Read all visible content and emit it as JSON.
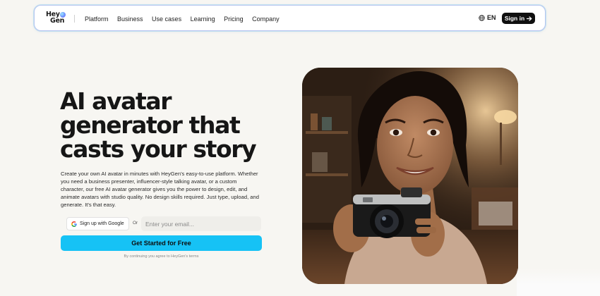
{
  "nav": {
    "logo_line1": "Hey",
    "logo_line2": "Gen",
    "items": [
      "Platform",
      "Business",
      "Use cases",
      "Learning",
      "Pricing",
      "Company"
    ],
    "lang": "EN",
    "signin": "Sign in"
  },
  "hero": {
    "title_line1": "AI avatar",
    "title_line2": "generator that",
    "title_line3": "casts your story",
    "description": "Create your own AI avatar in minutes with HeyGen's easy-to-use platform. Whether you need a business presenter, influencer-style talking avatar, or a custom character, our free AI avatar generator gives you the power to design, edit, and animate avatars with studio quality. No design skills required. Just type, upload, and generate. It's that easy.",
    "google_btn": "Sign up with Google",
    "or": "Or",
    "email_placeholder": "Enter your email...",
    "cta": "Get Started for Free",
    "terms": "By continuing you agree to HeyGen's terms"
  },
  "colors": {
    "accent": "#16c2f5",
    "background": "#f7f6f2",
    "nav_border": "#b9c6f0"
  },
  "icons": {
    "globe": "globe-icon",
    "arrow": "arrow-right-icon",
    "google": "google-icon"
  }
}
